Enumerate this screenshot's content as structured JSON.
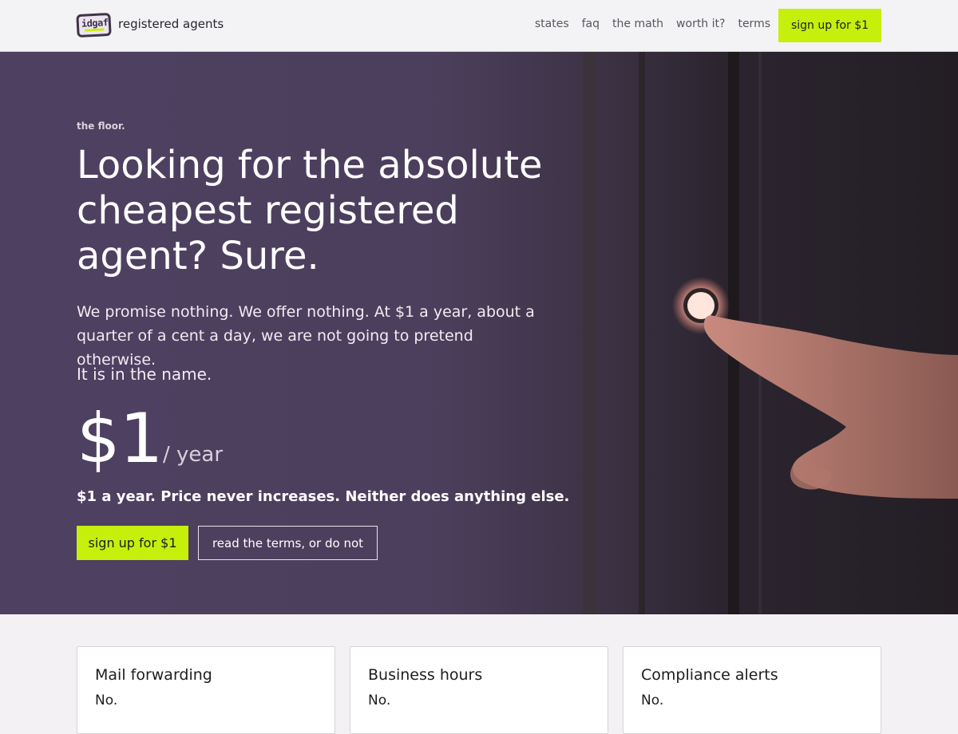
{
  "header": {
    "logo_text": "idgaf",
    "brand_name": "registered agents",
    "nav": [
      "states",
      "faq",
      "the math",
      "worth it?",
      "terms"
    ],
    "cta_label": "sign up for $1"
  },
  "hero": {
    "eyebrow": "the floor.",
    "headline": "Looking for the absolute cheapest registered agent? Sure.",
    "copy": "We promise nothing. We offer nothing. At $1 a year, about a quarter of a cent a day, we are not going to pretend otherwise.",
    "note": "It is in the name.",
    "price": "$1",
    "price_unit": "/ year",
    "tagline": "$1 a year. Price never increases. Neither does anything else.",
    "primary_button": "sign up for $1",
    "secondary_button": "read the terms, or do not"
  },
  "cards": [
    {
      "title": "Mail forwarding",
      "value": "No."
    },
    {
      "title": "Business hours",
      "value": "No."
    },
    {
      "title": "Compliance alerts",
      "value": "No."
    }
  ],
  "colors": {
    "accent": "#c6ef0c",
    "hero_purple": "#4e4061",
    "page_bg": "#f3f1f4"
  },
  "icons": {
    "logo": "idgaf-logo-icon"
  }
}
